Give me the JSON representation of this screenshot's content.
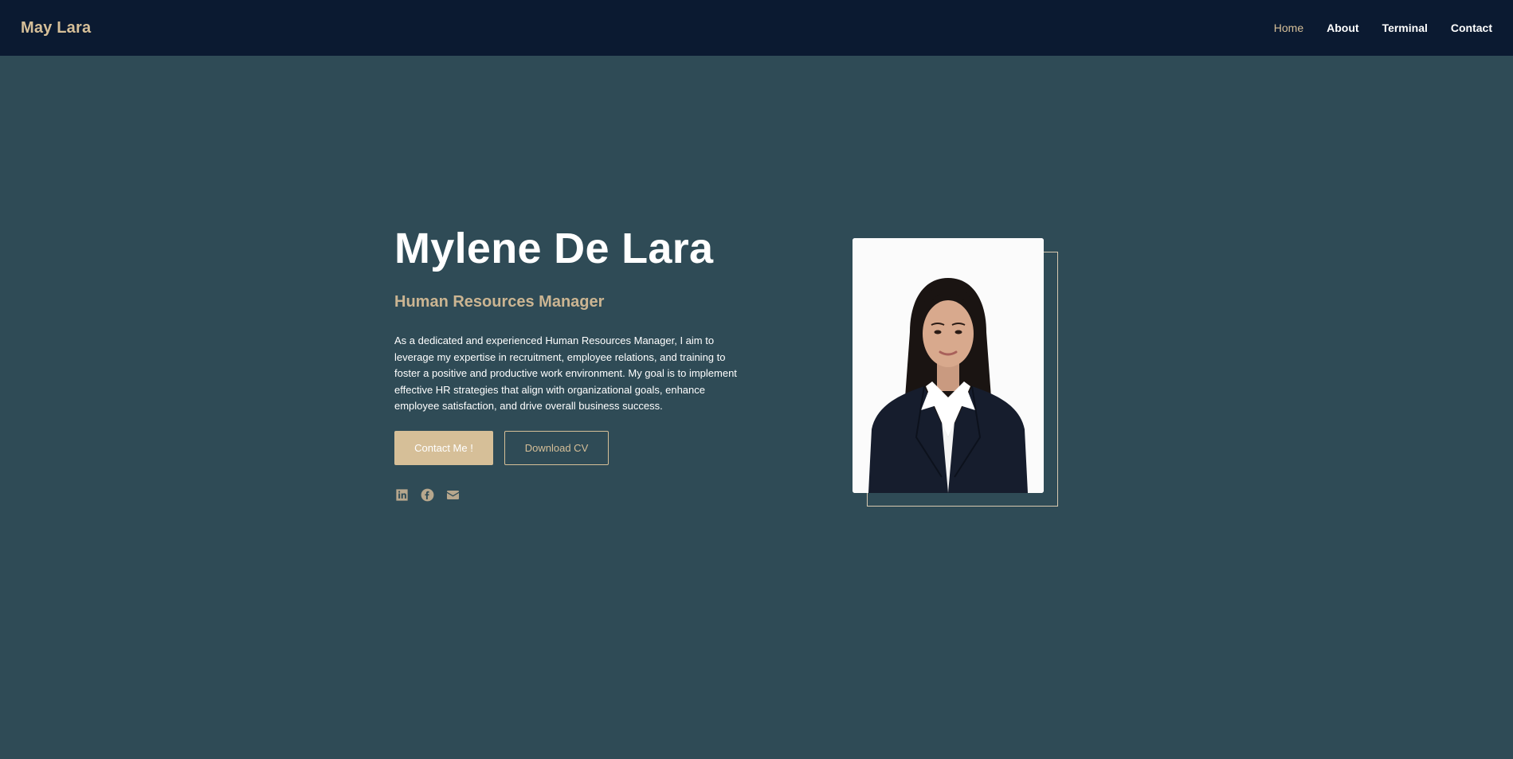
{
  "navbar": {
    "brand": "May Lara",
    "links": [
      {
        "label": "Home"
      },
      {
        "label": "About"
      },
      {
        "label": "Terminal"
      },
      {
        "label": "Contact"
      }
    ]
  },
  "hero": {
    "name": "Mylene De Lara",
    "role": "Human Resources Manager",
    "description": "As a dedicated and experienced Human Resources Manager, I aim to leverage my expertise in recruitment, employee relations, and training to foster a positive and productive work environment. My goal is to implement effective HR strategies that align with organizational goals, enhance employee satisfaction, and drive overall business success.",
    "buttons": {
      "contact": "Contact Me !",
      "download": "Download CV"
    },
    "social_icons": [
      "linkedin-icon",
      "facebook-icon",
      "email-icon"
    ]
  },
  "colors": {
    "navbar_bg": "#0b1a31",
    "page_bg": "#2f4b56",
    "accent": "#d6bf98",
    "text": "#ffffff"
  }
}
